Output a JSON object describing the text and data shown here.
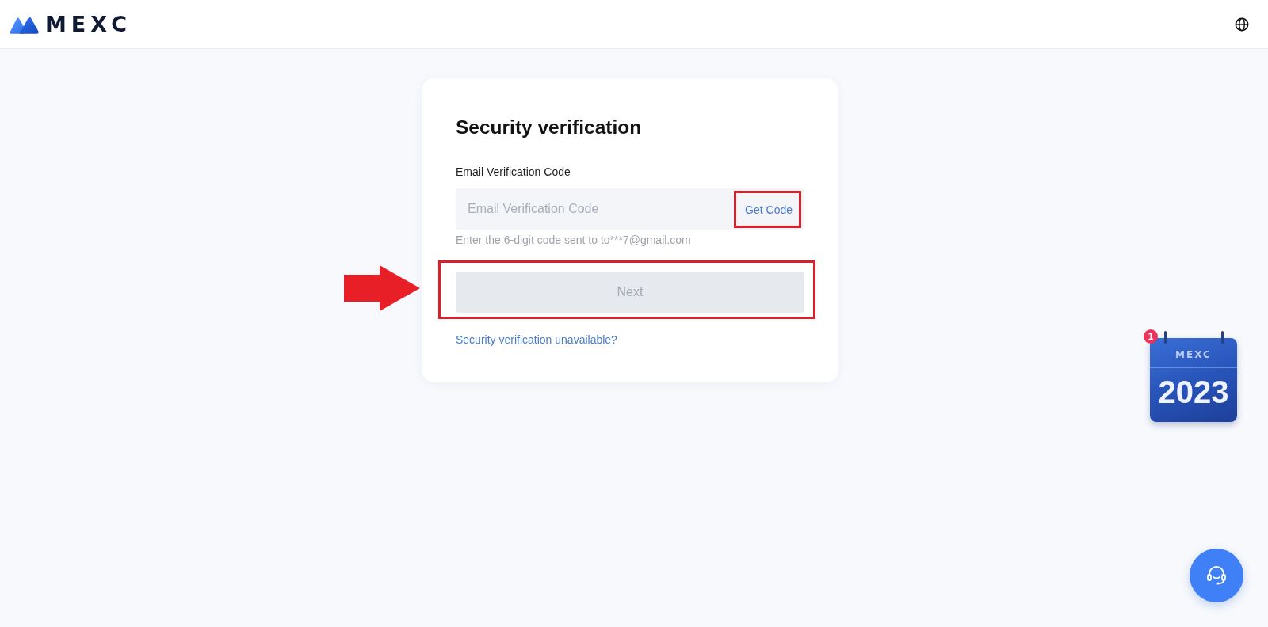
{
  "header": {
    "logo_text": "MEXC"
  },
  "card": {
    "title": "Security verification",
    "field": {
      "label": "Email Verification Code",
      "placeholder": "Email Verification Code",
      "hint": "Enter the 6-digit code sent to to***7@gmail.com"
    },
    "get_code": {
      "label": "Get Code",
      "highlighted": true
    },
    "next_button": {
      "label": "Next",
      "disabled": true,
      "highlighted": true,
      "arrow": true
    },
    "help_link": "Security verification unavailable?"
  },
  "promo_widget": {
    "badge": "1",
    "brand": "MEXC",
    "year": "2023"
  }
}
